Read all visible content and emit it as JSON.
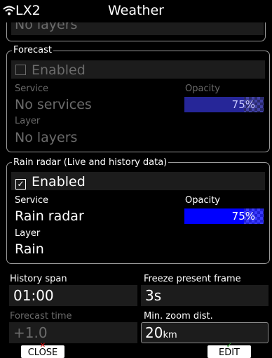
{
  "header": {
    "device": "LX2",
    "title": "Weather"
  },
  "top": {
    "layer_value": "No layers"
  },
  "forecast": {
    "group_label": "Forecast",
    "enabled_label": "Enabled",
    "service_label": "Service",
    "service_value": "No services",
    "opacity_label": "Opacity",
    "opacity_value": "75%",
    "opacity_level": 0.75,
    "layer_label": "Layer",
    "layer_value": "No layers"
  },
  "rain": {
    "group_label": "Rain radar (Live and history data)",
    "enabled_label": "Enabled",
    "service_label": "Service",
    "service_value": "Rain radar",
    "opacity_label": "Opacity",
    "opacity_value": "75%",
    "opacity_level": 0.75,
    "layer_label": "Layer",
    "layer_value": "Rain"
  },
  "settings": {
    "history_span_label": "History span",
    "history_span_value": "01:00",
    "freeze_label": "Freeze present frame",
    "freeze_value": "3s",
    "forecast_time_label": "Forecast time",
    "forecast_time_value": "+1.0",
    "min_zoom_label": "Min. zoom dist.",
    "min_zoom_value": "20",
    "min_zoom_unit": "km"
  },
  "buttons": {
    "close": "CLOSE",
    "edit": "EDIT"
  },
  "colors": {
    "accent": "#0000ff",
    "close_mark": "#d11",
    "edit_mark": "#2ca02c"
  }
}
